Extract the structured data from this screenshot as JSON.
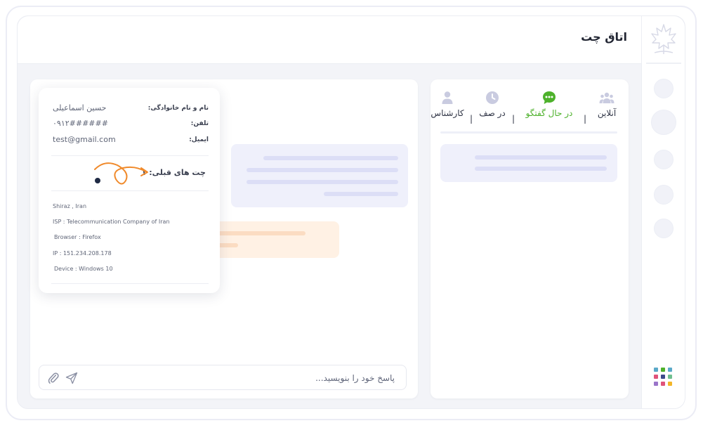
{
  "header": {
    "title": "اتاق چت"
  },
  "tabs": [
    {
      "label": "آنلاین",
      "icon": "users-icon",
      "active": false
    },
    {
      "label": "در حال گفتگو",
      "icon": "chat-bubble-icon",
      "active": true
    },
    {
      "label": "در صف",
      "icon": "clock-icon",
      "active": false
    },
    {
      "label": "کارشناس",
      "icon": "user-icon",
      "active": false
    }
  ],
  "tab_separator": "|",
  "visitor": {
    "name_label": "نام و نام خانوادگی:",
    "name_value": "حسین اسماعیلی",
    "phone_label": "تلفن:",
    "phone_value": "۰۹۱۲######",
    "email_label": "ایمیل:",
    "email_value": "test@gmail.com",
    "previous_chats": "چت های قبلی: ۱",
    "location": "Shiraz , Iran",
    "isp": "ISP : Telecommunication Company of Iran",
    "browser": "Browser : Firefox",
    "ip": "IP : 151.234.208.178",
    "device": "Device : Windows 10"
  },
  "composer": {
    "placeholder": "پاسخ خود را بنویسید..."
  },
  "colors": {
    "accent_green": "#4db12b",
    "tab_icon_gray": "#c9cbe0",
    "skeleton_purple": "#eff0fb",
    "skeleton_purple_line": "#dcdef6",
    "skeleton_orange": "#fff1e4",
    "skeleton_orange_line": "#fbdcc2",
    "arrow_orange": "#f08a2b"
  }
}
